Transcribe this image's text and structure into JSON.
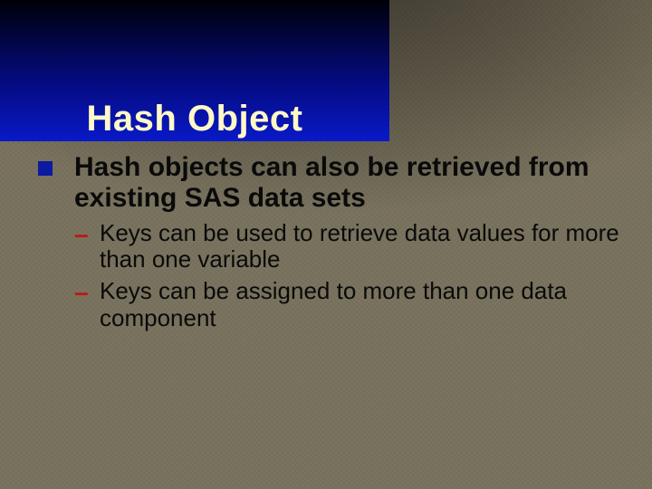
{
  "slide": {
    "title": "Hash Object",
    "bullets": [
      {
        "text": "Hash objects can also be retrieved from existing SAS data sets",
        "sub": [
          "Keys can be used to retrieve data values for more than one variable",
          "Keys can be assigned to more than one data component"
        ]
      }
    ]
  }
}
